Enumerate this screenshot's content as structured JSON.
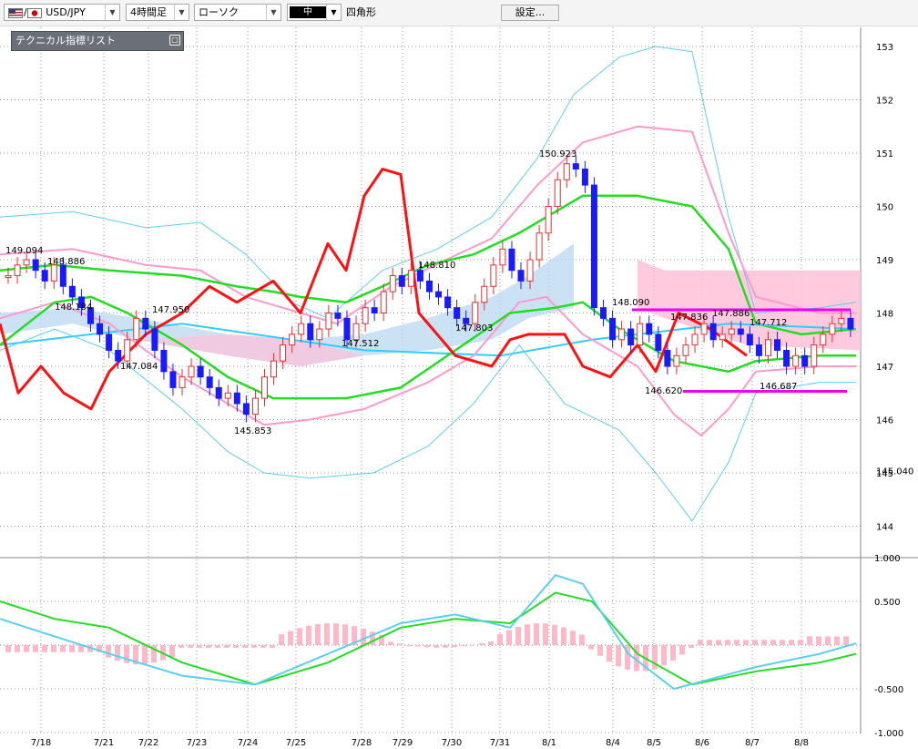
{
  "toolbar": {
    "symbol": "USD/JPY",
    "symbol_flags": [
      "us-flag-icon",
      "jp-flag-icon"
    ],
    "timeframe": "4時間足",
    "chart_style": "ローソク",
    "line_width_label": "中",
    "drawing_tool": "四角形",
    "settings_label": "設定..."
  },
  "indicator_panel": {
    "title": "テクニカル指標リスト"
  },
  "colors": {
    "bullish_candle": "#e03030",
    "bearish_candle": "#1a1aff",
    "bollinger_outer": "#5ccfef",
    "bollinger_inner": "#ff99cc",
    "moving_average": "#22dd22",
    "trend_line": "#33ccff",
    "oscillator": "#ff1111",
    "cloud": "#b8d8f0",
    "cloud_alt": "#ffc0d8",
    "highlight_lines": "#ee00ee",
    "histogram": "#ffb8c8"
  },
  "chart_data": [
    {
      "type": "candlestick",
      "x_labels": [
        "7/18",
        "7/21",
        "7/22",
        "7/23",
        "7/24",
        "7/25",
        "7/28",
        "7/29",
        "7/30",
        "7/31",
        "8/1",
        "8/4",
        "8/5",
        "8/6",
        "8/7",
        "8/8"
      ],
      "y_ticks": [
        "153",
        "152",
        "151",
        "150",
        "149",
        "148",
        "147",
        "146",
        "145",
        "144"
      ],
      "ylim": [
        143.3,
        153.3
      ],
      "price_labels": [
        "149.094",
        "148.886",
        "148.184",
        "147.950",
        "147.084",
        "145.853",
        "147.512",
        "148.810",
        "147.803",
        "150.923",
        "148.090",
        "147.836",
        "147.886",
        "147.712",
        "146.620",
        "146.687"
      ],
      "last_price_label": "145.040",
      "close": [
        148.7,
        148.9,
        149.0,
        148.8,
        148.6,
        148.9,
        148.5,
        148.3,
        148.1,
        147.8,
        147.6,
        147.3,
        147.1,
        147.5,
        147.9,
        147.7,
        147.3,
        146.9,
        146.6,
        146.8,
        147.0,
        146.8,
        146.6,
        146.4,
        146.5,
        146.3,
        146.1,
        146.4,
        146.8,
        147.1,
        147.4,
        147.6,
        147.8,
        147.5,
        147.7,
        148.0,
        147.9,
        147.5,
        147.8,
        148.1,
        148.0,
        148.4,
        148.7,
        148.5,
        148.8,
        148.6,
        148.4,
        148.3,
        148.1,
        147.9,
        147.8,
        148.2,
        148.5,
        148.9,
        149.2,
        148.8,
        148.6,
        149.0,
        149.5,
        150.0,
        150.5,
        150.8,
        150.7,
        150.4,
        148.1,
        147.9,
        147.5,
        147.7,
        147.4,
        147.8,
        147.6,
        147.3,
        147.0,
        147.2,
        147.4,
        147.6,
        147.8,
        147.5,
        147.6,
        147.7,
        147.6,
        147.4,
        147.2,
        147.5,
        147.3,
        147.0,
        147.2,
        147.0,
        147.4,
        147.6,
        147.8,
        147.9,
        147.7
      ]
    },
    {
      "type": "line",
      "title": "",
      "y_ticks": [
        "1.000",
        "0.500",
        "-0.500",
        "-1.000"
      ],
      "ylim": [
        -1.0,
        1.0
      ]
    }
  ]
}
